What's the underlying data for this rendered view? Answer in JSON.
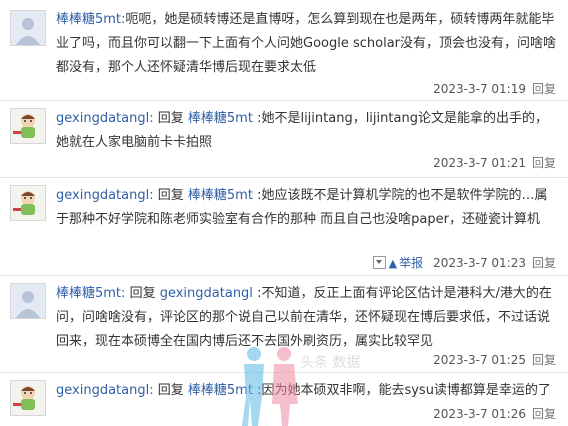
{
  "comments": [
    {
      "author": "棒棒糖5mt:",
      "body": "呃呃，她是硕转博还是直博呀，怎么算到现在也是两年，硕转博两年就能毕业了吗，而且你可以翻一下上面有个人问她Google scholar没有，顶会也没有，问啥啥都没有，那个人还怀疑清华博后现在要求太低",
      "time": "2023-3-7 01:19",
      "reply_label": "回复"
    },
    {
      "author": "gexingdatangl:",
      "reply_word": "回复",
      "reply_to": "棒棒糖5mt",
      "body": ":她不是lijintang，lijintang论文是能拿的出手的，她就在人家电脑前卡卡拍照",
      "time": "2023-3-7 01:21",
      "reply_label": "回复"
    },
    {
      "author": "gexingdatangl:",
      "reply_word": "回复",
      "reply_to": "棒棒糖5mt",
      "body": ":她应该既不是计算机学院的也不是软件学院的…属于那种不好学院和陈老师实验室有合作的那种 而且自己也没啥paper，还碰瓷计算机",
      "report_label": "举报",
      "time": "2023-3-7 01:23",
      "reply_label": "回复"
    },
    {
      "author": "棒棒糖5mt:",
      "reply_word": "回复",
      "reply_to": "gexingdatangl",
      "body": ":不知道，反正上面有评论区估计是港科大/港大的在问，问啥啥没有，评论区的那个说自己以前在清华，还怀疑现在博后要求低，不过话说回来，现在本硕博全在国内博后还不去国外刷资历，属实比较罕见",
      "time": "2023-3-7 01:25",
      "reply_label": "回复"
    },
    {
      "author": "gexingdatangl:",
      "reply_word": "回复",
      "reply_to": "棒棒糖5mt",
      "body": ":因为她本硕双非啊，能去sysu读博都算是幸运的了",
      "time": "2023-3-7 01:26",
      "reply_label": "回复"
    }
  ],
  "watermark_text": "头条 数据"
}
